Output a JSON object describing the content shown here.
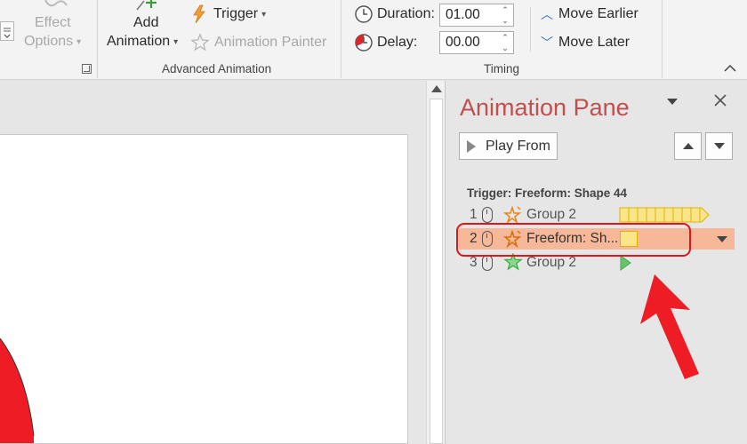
{
  "ribbon": {
    "effect_options": {
      "line1": "Effect",
      "line2": "Options"
    },
    "add_animation": {
      "line1": "Add",
      "line2": "Animation"
    },
    "trigger": "Trigger",
    "animation_painter": "Animation Painter",
    "advanced_group_label": "Advanced Animation",
    "duration_label": "Duration:",
    "duration_value": "01.00",
    "delay_label": "Delay:",
    "delay_value": "00.00",
    "move_earlier": "Move Earlier",
    "move_later": "Move Later",
    "timing_group_label": "Timing"
  },
  "pane": {
    "title": "Animation Pane",
    "play_from": "Play From",
    "trigger_header": "Trigger: Freeform: Shape 44",
    "rows": [
      {
        "num": "1",
        "name": "Group 2"
      },
      {
        "num": "2",
        "name": "Freeform: Sh..."
      },
      {
        "num": "3",
        "name": "Group 2"
      }
    ]
  },
  "colors": {
    "accent_title": "#c0504d",
    "selection": "#f7b899",
    "annotation_red": "#e0161b",
    "effect_yellow": "#fbe58a",
    "entrance_green": "#3cb043"
  }
}
